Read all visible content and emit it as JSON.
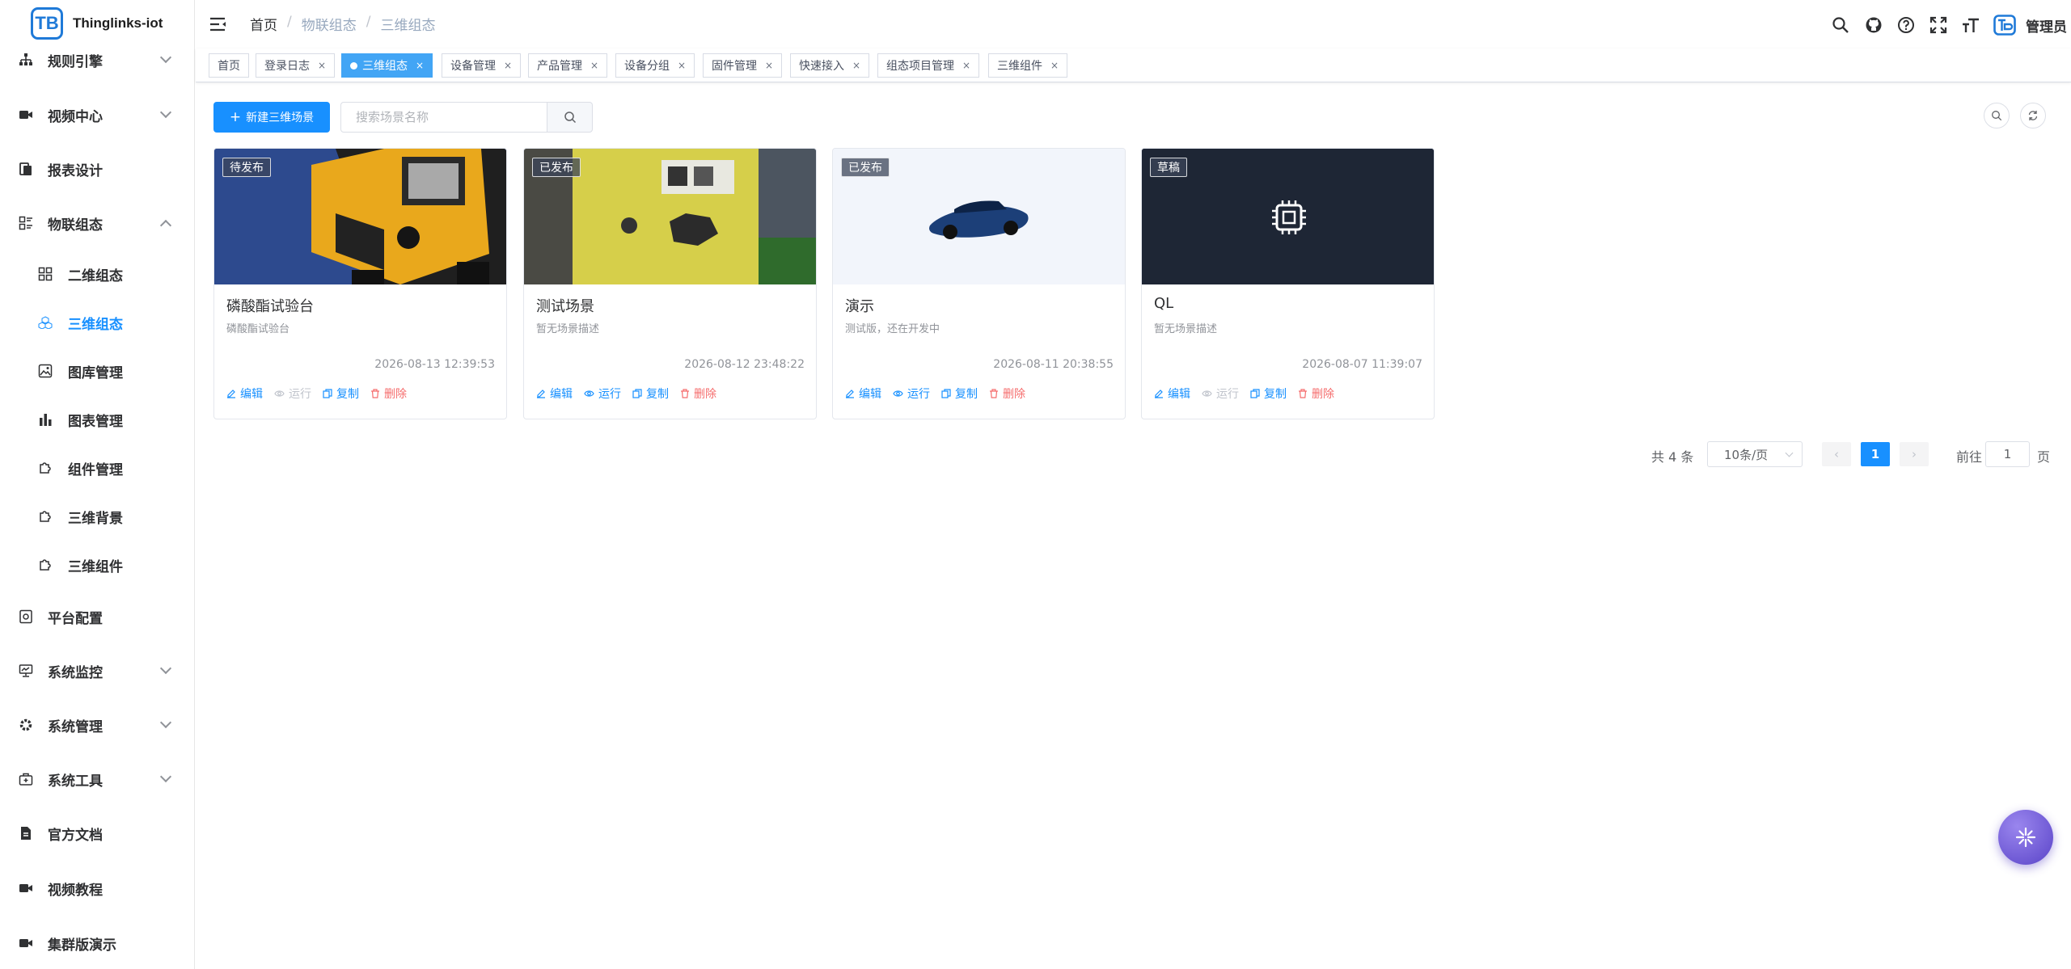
{
  "app": {
    "name": "Thinglinks-iot",
    "logo_letters": "TB"
  },
  "sidebar": {
    "items": [
      {
        "label": "规则引擎",
        "icon": "sitemap-icon",
        "expandable": true
      },
      {
        "label": "视频中心",
        "icon": "video-icon",
        "expandable": true
      },
      {
        "label": "报表设计",
        "icon": "report-icon",
        "expandable": false
      },
      {
        "label": "物联组态",
        "icon": "layout-icon",
        "expandable": true,
        "expanded": true
      },
      {
        "label": "平台配置",
        "icon": "config-icon",
        "expandable": false
      },
      {
        "label": "系统监控",
        "icon": "monitor-icon",
        "expandable": true
      },
      {
        "label": "系统管理",
        "icon": "gear-icon",
        "expandable": true
      },
      {
        "label": "系统工具",
        "icon": "toolbox-icon",
        "expandable": true
      },
      {
        "label": "官方文档",
        "icon": "document-icon",
        "expandable": false
      },
      {
        "label": "视频教程",
        "icon": "video-icon",
        "expandable": false
      },
      {
        "label": "集群版演示",
        "icon": "video-icon",
        "expandable": false
      }
    ],
    "subitems": [
      {
        "label": "二维组态",
        "icon": "grid-icon"
      },
      {
        "label": "三维组态",
        "icon": "cubes-icon",
        "active": true
      },
      {
        "label": "图库管理",
        "icon": "image-icon"
      },
      {
        "label": "图表管理",
        "icon": "bar-chart-icon"
      },
      {
        "label": "组件管理",
        "icon": "puzzle-icon"
      },
      {
        "label": "三维背景",
        "icon": "puzzle-icon"
      },
      {
        "label": "三维组件",
        "icon": "puzzle-icon"
      }
    ]
  },
  "header": {
    "breadcrumb": [
      "首页",
      "物联组态",
      "三维组态"
    ],
    "breadcrumb_sep": "/",
    "user_name": "管理员"
  },
  "tags": [
    {
      "label": "首页",
      "closable": false
    },
    {
      "label": "登录日志",
      "closable": true
    },
    {
      "label": "三维组态",
      "closable": true,
      "active": true
    },
    {
      "label": "设备管理",
      "closable": true
    },
    {
      "label": "产品管理",
      "closable": true
    },
    {
      "label": "设备分组",
      "closable": true
    },
    {
      "label": "固件管理",
      "closable": true
    },
    {
      "label": "快速接入",
      "closable": true
    },
    {
      "label": "组态项目管理",
      "closable": true
    },
    {
      "label": "三维组件",
      "closable": true
    }
  ],
  "tag_close_glyph": "×",
  "toolbar": {
    "new_label": "新建三维场景",
    "new_prefix": "+",
    "search_placeholder": "搜索场景名称"
  },
  "cards": [
    {
      "title": "磷酸酯试验台",
      "desc": "磷酸酯试验台",
      "badge": "待发布",
      "time": "2026-08-13 12:39:53",
      "thumb": "generator-blue",
      "run_enabled": false
    },
    {
      "title": "测试场景",
      "desc": "暂无场景描述",
      "badge": "已发布",
      "time": "2026-08-12 23:48:22",
      "thumb": "generator-field",
      "run_enabled": true
    },
    {
      "title": "演示",
      "desc": "测试版，还在开发中",
      "badge": "已发布",
      "time": "2026-08-11 20:38:55",
      "thumb": "car",
      "run_enabled": true
    },
    {
      "title": "QL",
      "desc": "暂无场景描述",
      "badge": "草稿",
      "time": "2026-08-07 11:39:07",
      "thumb": "chip",
      "run_enabled": false
    }
  ],
  "card_actions": {
    "edit": "编辑",
    "run": "运行",
    "copy": "复制",
    "delete": "删除"
  },
  "pagination": {
    "total_text": "共 4 条",
    "page_size": "10条/页",
    "current_page": "1",
    "prev_glyph": "‹",
    "next_glyph": "›",
    "goto_label": "前往",
    "goto_value": "1",
    "goto_suffix": "页"
  },
  "colors": {
    "primary": "#1890ff",
    "danger": "#f56c6c",
    "active_tag": "#42a5f5"
  }
}
